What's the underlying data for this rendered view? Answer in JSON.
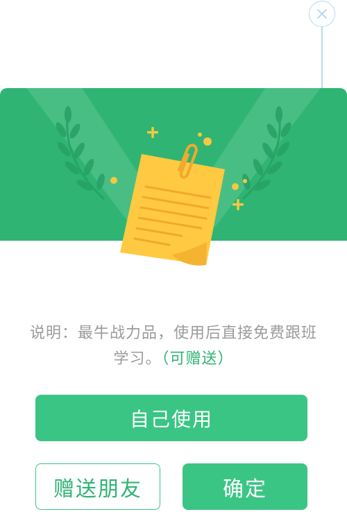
{
  "colors": {
    "banner": "#2fb474",
    "primary_button": "#3ac584",
    "accent_text": "#2fb474",
    "description_text": "#9b9b9b",
    "close_ring": "#b3daf1",
    "note_yellow": "#ffc941"
  },
  "dialog": {
    "close_icon": "close-icon",
    "illustration_icon": "paper-note-with-clip-icon",
    "description": {
      "text": "说明：最牛战力品，使用后直接免费跟班学习。",
      "gift_note": "（可赠送）"
    },
    "buttons": {
      "use_self": "自己使用",
      "gift_friend": "赠送朋友",
      "confirm": "确定"
    }
  }
}
